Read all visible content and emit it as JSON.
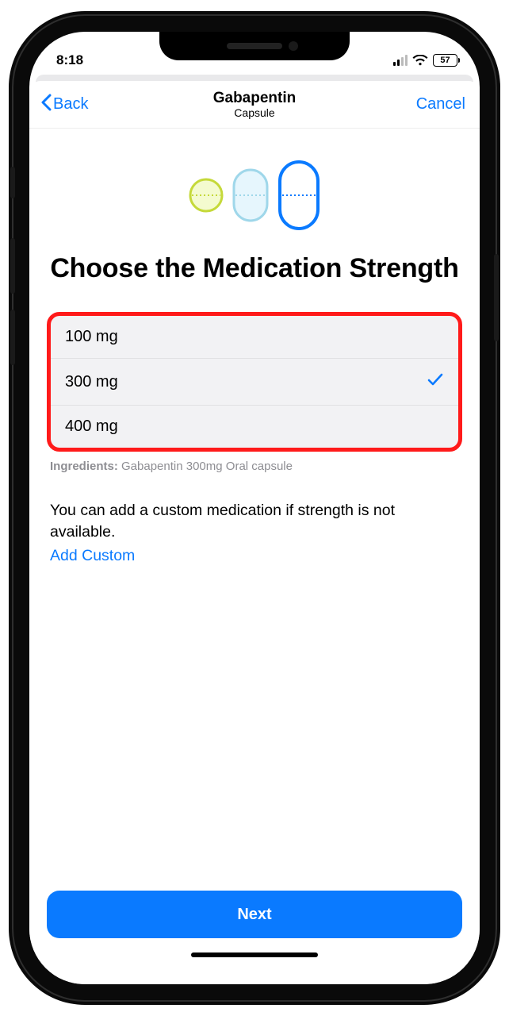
{
  "status": {
    "time": "8:18",
    "battery": "57"
  },
  "nav": {
    "back": "Back",
    "title": "Gabapentin",
    "subtitle": "Capsule",
    "cancel": "Cancel"
  },
  "headline": "Choose the Medication Strength",
  "strengths": [
    {
      "label": "100 mg",
      "selected": false
    },
    {
      "label": "300 mg",
      "selected": true
    },
    {
      "label": "400 mg",
      "selected": false
    }
  ],
  "ingredients": {
    "label": "Ingredients:",
    "value": "Gabapentin 300mg Oral capsule"
  },
  "hint": "You can add a custom medication if strength is not available.",
  "addCustom": "Add Custom",
  "nextButton": "Next"
}
